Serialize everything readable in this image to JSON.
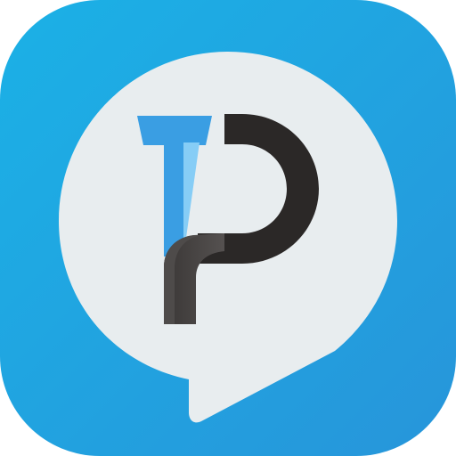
{
  "app_icon": {
    "logo_text": "TP",
    "icon_name": "tp-speech-bubble-app-icon"
  },
  "colors": {
    "tile_gradient_start": "#1bb1e6",
    "tile_gradient_end": "#2795da",
    "bubble": "#e8edef",
    "letter_t_dark": "#3a9ee3",
    "letter_t_light": "#86cdf6",
    "letter_p_dark": "#2b2827",
    "letter_p_gray": "#4e4b4a"
  }
}
